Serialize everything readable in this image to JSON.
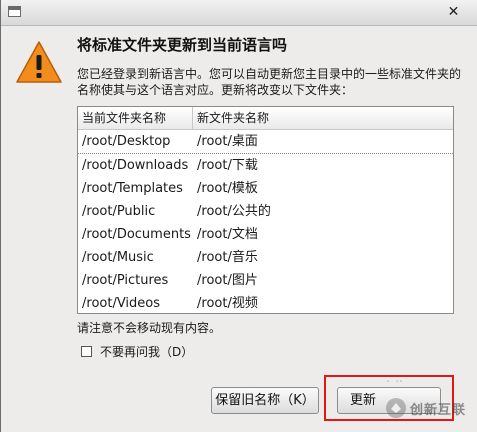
{
  "dialog": {
    "heading": "将标准文件夹更新到当前语言吗",
    "description": "您已经登录到新语言中。您可以自动更新您主目录中的一些标准文件夹的名称使其与这个语言对应。更新将改变以下文件夹："
  },
  "table": {
    "headers": {
      "current": "当前文件夹名称",
      "new": "新文件夹名称"
    },
    "rows": [
      {
        "current": "/root/Desktop",
        "new": "/root/桌面"
      },
      {
        "current": "/root/Downloads",
        "new": "/root/下载"
      },
      {
        "current": "/root/Templates",
        "new": "/root/模板"
      },
      {
        "current": "/root/Public",
        "new": "/root/公共的"
      },
      {
        "current": "/root/Documents",
        "new": "/root/文档"
      },
      {
        "current": "/root/Music",
        "new": "/root/音乐"
      },
      {
        "current": "/root/Pictures",
        "new": "/root/图片"
      },
      {
        "current": "/root/Videos",
        "new": "/root/视频"
      }
    ]
  },
  "note": "请注意不会移动现有内容。",
  "checkbox": {
    "label": "不要再问我（D）",
    "checked": false
  },
  "buttons": {
    "keep": "保留旧名称（K）",
    "update": "更新"
  },
  "watermark": {
    "text": "创新互联"
  },
  "icons": {
    "warning": "warning-icon",
    "window": "window-icon",
    "close": "close-icon"
  },
  "colors": {
    "highlight": "#e41717",
    "warning_fill": "#f28c1c"
  }
}
